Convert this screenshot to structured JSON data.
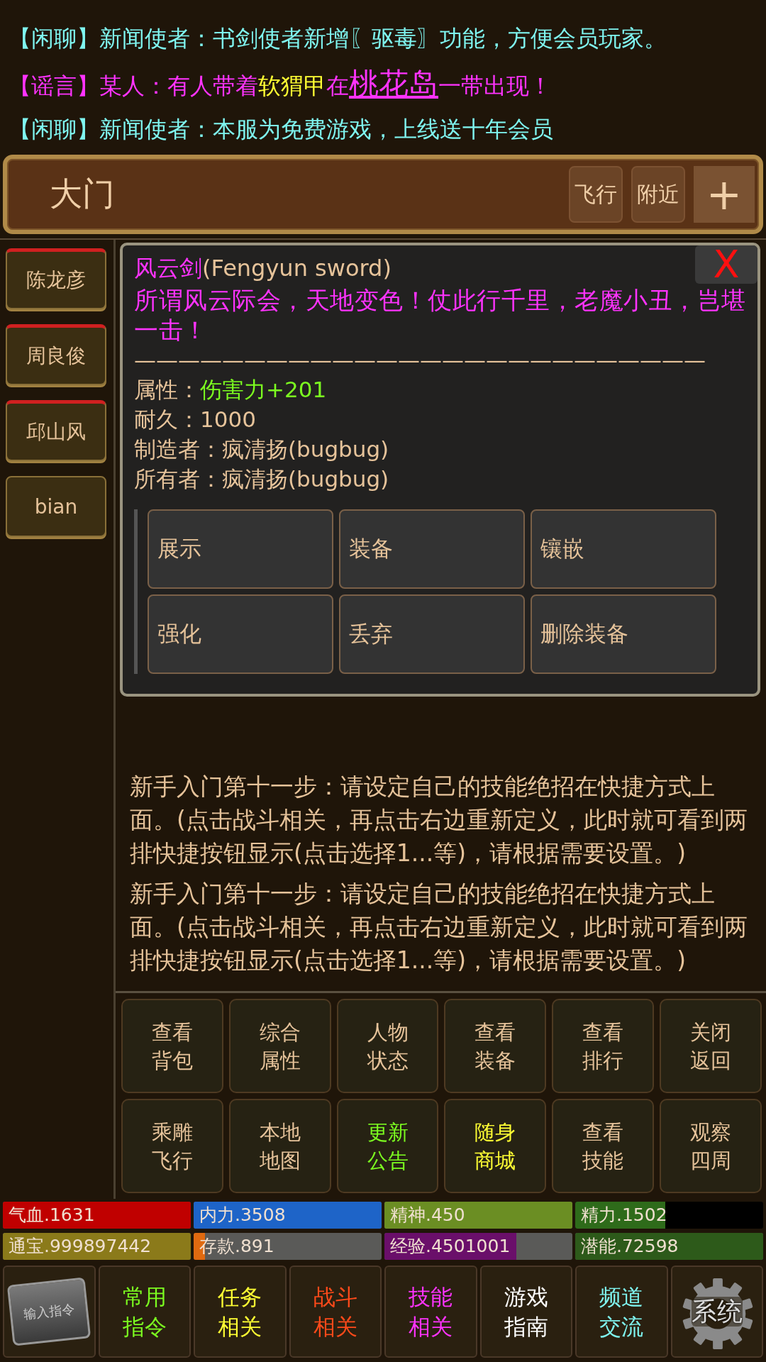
{
  "chat": [
    {
      "segments": [
        {
          "text": "【闲聊】",
          "kind": "chat"
        },
        {
          "text": "新闻使者：书剑使者新增〖驱毒〗功能，方便会员玩家。",
          "kind": "chat"
        }
      ]
    },
    {
      "segments": [
        {
          "text": "【谣言】",
          "kind": "rumor"
        },
        {
          "text": "某人：有人带着",
          "kind": "rumor"
        },
        {
          "text": "软猬甲",
          "kind": "item"
        },
        {
          "text": "在",
          "kind": "rumor"
        },
        {
          "text": "桃花岛",
          "kind": "place"
        },
        {
          "text": "一带出现！",
          "kind": "rumor"
        }
      ]
    },
    {
      "segments": [
        {
          "text": "【闲聊】",
          "kind": "chat"
        },
        {
          "text": "新闻使者：本服为免费游戏，上线送十年会员",
          "kind": "chat"
        }
      ]
    }
  ],
  "location": {
    "title": "大门",
    "actions": [
      "飞行",
      "附近"
    ],
    "add": "+"
  },
  "npcs": [
    {
      "name": "陈龙彦",
      "marked": true
    },
    {
      "name": "周良俊",
      "marked": true
    },
    {
      "name": "邱山风",
      "marked": true
    },
    {
      "name": "bian",
      "marked": false
    }
  ],
  "item_popup": {
    "name": "风云剑",
    "english": "(Fengyun sword)",
    "description": "所谓风云际会，天地变色！仗此行千里，老魔小丑，岂堪一击！",
    "separator": "——————————————————————————",
    "close": "X",
    "attributes": [
      {
        "label": "属性：",
        "value": "伤害力+201",
        "kind": "bonus"
      },
      {
        "label": "耐久：",
        "value": "1000",
        "kind": "plain"
      },
      {
        "label": "制造者：",
        "value": "疯清扬(bugbug)",
        "kind": "plain"
      },
      {
        "label": "所有者：",
        "value": "疯清扬(bugbug)",
        "kind": "plain"
      }
    ],
    "actions": [
      "展示",
      "装备",
      "镶嵌",
      "强化",
      "丢弃",
      "删除装备"
    ]
  },
  "log": [
    "新手入门第十一步：请设定自己的技能绝招在快捷方式上面。(点击战斗相关，再点击右边重新定义，此时就可看到两排快捷按钮显示(点击选择1...等)，请根据需要设置。)",
    "新手入门第十一步：请设定自己的技能绝招在快捷方式上面。(点击战斗相关，再点击右边重新定义，此时就可看到两排快捷按钮显示(点击选择1...等)，请根据需要设置。)"
  ],
  "menu": [
    {
      "lines": [
        "查看",
        "背包"
      ],
      "color": "#e6c39a"
    },
    {
      "lines": [
        "综合",
        "属性"
      ],
      "color": "#e6c39a"
    },
    {
      "lines": [
        "人物",
        "状态"
      ],
      "color": "#e6c39a"
    },
    {
      "lines": [
        "查看",
        "装备"
      ],
      "color": "#e6c39a"
    },
    {
      "lines": [
        "查看",
        "排行"
      ],
      "color": "#e6c39a"
    },
    {
      "lines": [
        "关闭",
        "返回"
      ],
      "color": "#e6c39a"
    },
    {
      "lines": [
        "乘雕",
        "飞行"
      ],
      "color": "#e6c39a"
    },
    {
      "lines": [
        "本地",
        "地图"
      ],
      "color": "#e6c39a"
    },
    {
      "lines": [
        "更新",
        "公告"
      ],
      "color": "#7cfc20"
    },
    {
      "lines": [
        "随身",
        "商城"
      ],
      "color": "#ffff33"
    },
    {
      "lines": [
        "查看",
        "技能"
      ],
      "color": "#e6c39a"
    },
    {
      "lines": [
        "观察",
        "四周"
      ],
      "color": "#e6c39a"
    }
  ],
  "stats": [
    {
      "label": "气血.1631",
      "level": 1,
      "color": "#c00000",
      "kind": "gray"
    },
    {
      "label": "内力.3508",
      "level": 1,
      "color": "#1e64c8",
      "kind": "gray"
    },
    {
      "label": "精神.450",
      "level": 1,
      "color": "#6b8e23",
      "kind": "gray"
    },
    {
      "label": "精力.1502",
      "level": 0.48,
      "color": "#2e6b1a",
      "kind": "dark"
    },
    {
      "label": "通宝.999897442",
      "level": 1,
      "color": "#8b7a1a",
      "kind": "gray"
    },
    {
      "label": "存款.891",
      "level": 0.06,
      "color": "#e06a10",
      "kind": "gray"
    },
    {
      "label": "经验.4501001",
      "level": 0.7,
      "color": "#6a0f6a",
      "kind": "gray"
    },
    {
      "label": "潜能.72598",
      "level": 1,
      "color": "#2d5a1a",
      "kind": "gray"
    }
  ],
  "nav": [
    {
      "kind": "command",
      "label": "输入指令"
    },
    {
      "kind": "text",
      "lines": [
        "常用",
        "指令"
      ],
      "color": "#7cfc20"
    },
    {
      "kind": "text",
      "lines": [
        "任务",
        "相关"
      ],
      "color": "#ffff33"
    },
    {
      "kind": "text",
      "lines": [
        "战斗",
        "相关"
      ],
      "color": "#ff4a1a"
    },
    {
      "kind": "text",
      "lines": [
        "技能",
        "相关"
      ],
      "color": "#ff33ff"
    },
    {
      "kind": "text",
      "lines": [
        "游戏",
        "指南"
      ],
      "color": "#ffffff"
    },
    {
      "kind": "text",
      "lines": [
        "频道",
        "交流"
      ],
      "color": "#7ff5f0"
    },
    {
      "kind": "system",
      "label": "系统"
    }
  ]
}
